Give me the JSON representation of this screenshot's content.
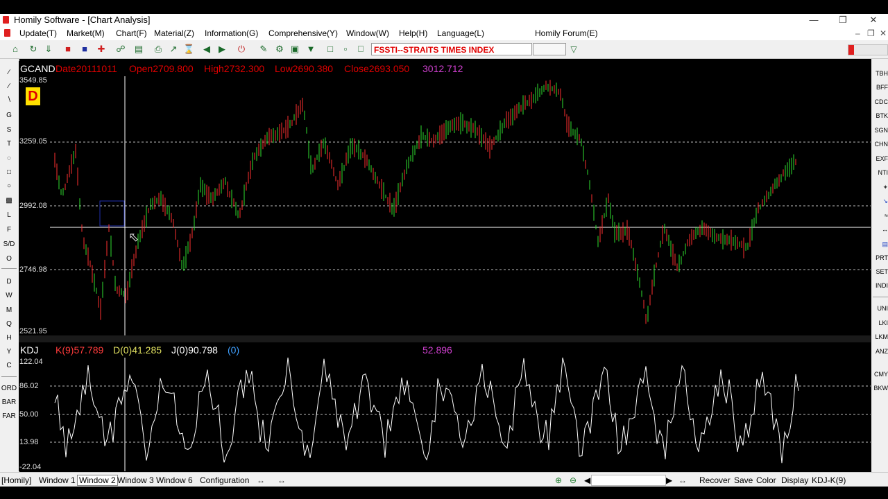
{
  "window": {
    "title": "Homily Software - [Chart Analysis]"
  },
  "menu": [
    "Update(T)",
    "Market(M)",
    "Chart(F)",
    "Material(Z)",
    "Information(G)",
    "Comprehensive(Y)",
    "Window(W)",
    "Help(H)",
    "Language(L)",
    "Homily Forum(E)"
  ],
  "toolbar": {
    "stock": "FSSTI--STRAITS TIMES INDEX"
  },
  "left_tools": [
    "G",
    "S",
    "T",
    "L",
    "F",
    "S/D",
    "O",
    "D",
    "W",
    "M",
    "Q",
    "H",
    "Y",
    "C",
    "ORD",
    "BAR",
    "FAR"
  ],
  "right_tools": [
    "TBH",
    "BFF",
    "CDC",
    "BTK",
    "SGN",
    "CHN",
    "EXF",
    "NTI",
    "PRT",
    "SET",
    "INDI",
    "UNI",
    "LKI",
    "LKM",
    "ANZ",
    "CMY",
    "BKW"
  ],
  "main_chart": {
    "label": "GCAND",
    "date": "Date20111011",
    "open": "Open2709.800",
    "high": "High2732.300",
    "low": "Low2690.380",
    "close": "Close2693.050",
    "cursor_value": "3012.712",
    "period_badge": "D",
    "y_ticks": [
      "3549.85",
      "3259.05",
      "2992.08",
      "2746.98",
      "2521.95"
    ]
  },
  "kdj": {
    "label": "KDJ",
    "k": "K(9)57.789",
    "d": "D(0)41.285",
    "j": "J(0)90.798",
    "extra": "(0)",
    "cursor_value": "52.896",
    "y_ticks": [
      "122.04",
      "86.02",
      "50.00",
      "13.98",
      "-22.04"
    ]
  },
  "bottom": {
    "app": "[Homily]",
    "tabs": [
      "Window 1",
      "Window 2",
      "Window 3",
      "Window 6",
      "Configuration"
    ],
    "selected_tab": "Window 2",
    "actions": [
      "Recover",
      "Save",
      "Color",
      "Display"
    ],
    "indicator": "KDJ-K(9)"
  },
  "colors": {
    "accent_red": "#e00000",
    "kdj_k": "#ff3b3b",
    "kdj_d": "#e0e060",
    "kdj_j": "#ffffff",
    "kdj_extra": "#3fa0ff",
    "cursor_value": "#d040d0"
  }
}
